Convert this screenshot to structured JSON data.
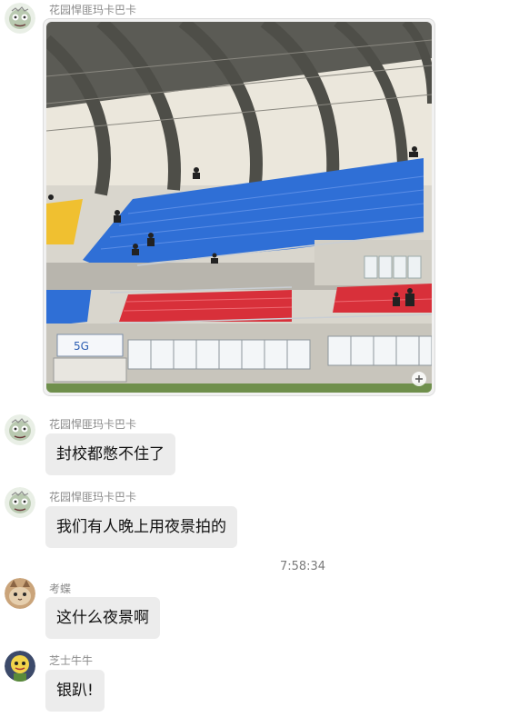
{
  "messages": [
    {
      "sender": "花园悍匪玛卡巴卡",
      "type": "image",
      "avatar_icon": "zombie-avatar-icon"
    },
    {
      "sender": "花园悍匪玛卡巴卡",
      "type": "text",
      "text": "封校都憋不住了",
      "avatar_icon": "zombie-avatar-icon"
    },
    {
      "sender": "花园悍匪玛卡巴卡",
      "type": "text",
      "text": "我们有人晚上用夜景拍的",
      "avatar_icon": "zombie-avatar-icon"
    },
    {
      "sender": "考蝶",
      "type": "text",
      "text": "这什么夜景啊",
      "avatar_icon": "cat-avatar-icon"
    },
    {
      "sender": "芝士牛牛",
      "type": "text",
      "text": "银趴!",
      "avatar_icon": "plant-avatar-icon"
    }
  ],
  "timestamp": "7:58:34",
  "photo": {
    "sign_text": "5G",
    "colors": {
      "blue_seats": "#2f6fd6",
      "red_seats": "#d8303a",
      "yellow_seats": "#f0c030",
      "roof": "#5b5b55",
      "wall": "#d9d6cd"
    }
  }
}
